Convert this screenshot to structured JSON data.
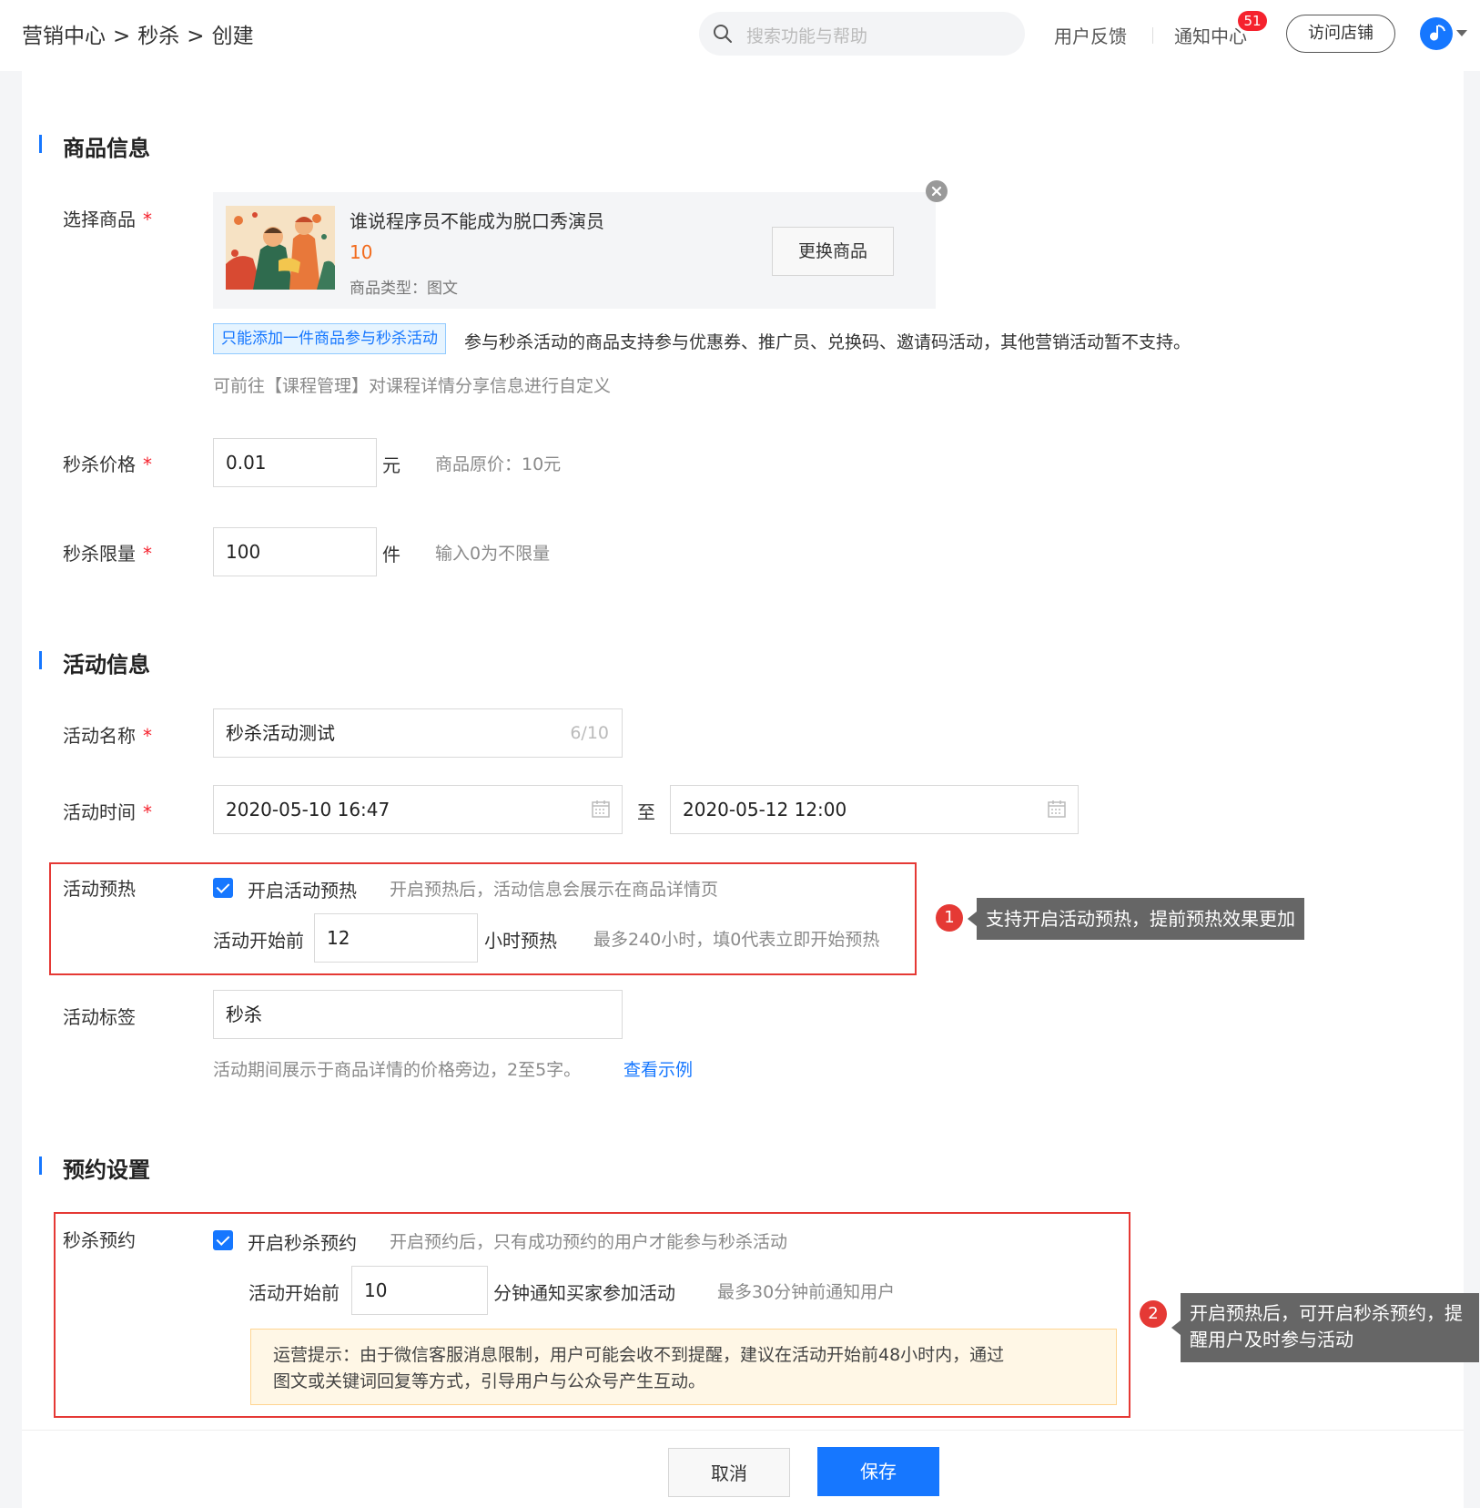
{
  "header": {
    "breadcrumb": [
      "营销中心",
      "秒杀",
      "创建"
    ],
    "breadcrumb_sep": ">",
    "search_placeholder": "搜索功能与帮助",
    "feedback": "用户反馈",
    "notify": "通知中心",
    "notify_badge": "51",
    "visit_shop": "访问店铺"
  },
  "product_section": {
    "title": "商品信息",
    "select_label": "选择商品",
    "product_title": "谁说程序员不能成为脱口秀演员",
    "product_price": "10",
    "product_type": "商品类型：图文",
    "change_button": "更换商品",
    "limit_tag": "只能添加一件商品参与秒杀活动",
    "support_text": "参与秒杀活动的商品支持参与优惠券、推广员、兑换码、邀请码活动，其他营销活动暂不支持。",
    "customize_hint": "可前往【课程管理】对课程详情分享信息进行自定义",
    "price_label": "秒杀价格",
    "price_value": "0.01",
    "price_unit": "元",
    "original_price": "商品原价：10元",
    "limit_label": "秒杀限量",
    "limit_value": "100",
    "limit_unit": "件",
    "limit_hint": "输入0为不限量"
  },
  "activity_section": {
    "title": "活动信息",
    "name_label": "活动名称",
    "name_value": "秒杀活动测试",
    "name_count": "6/10",
    "time_label": "活动时间",
    "start_time": "2020-05-10 16:47",
    "to": "至",
    "end_time": "2020-05-12 12:00",
    "preheat_label": "活动预热",
    "preheat_checkbox": "开启活动预热",
    "preheat_hint": "开启预热后，活动信息会展示在商品详情页",
    "preheat_before": "活动开始前",
    "preheat_hours": "12",
    "preheat_unit": "小时预热",
    "preheat_max": "最多240小时，填0代表立即开始预热",
    "tag_label": "活动标签",
    "tag_value": "秒杀",
    "tag_hint": "活动期间展示于商品详情的价格旁边，2至5字。",
    "tag_example_link": "查看示例"
  },
  "reserve_section": {
    "title": "预约设置",
    "reserve_label": "秒杀预约",
    "reserve_checkbox": "开启秒杀预约",
    "reserve_hint": "开启预约后，只有成功预约的用户才能参与秒杀活动",
    "reserve_before": "活动开始前",
    "reserve_minutes": "10",
    "reserve_unit": "分钟通知买家参加活动",
    "reserve_max": "最多30分钟前通知用户",
    "notice_line1": "运营提示：由于微信客服消息限制，用户可能会收不到提醒，建议在活动开始前48小时内，通过",
    "notice_line2": "图文或关键词回复等方式，引导用户与公众号产生互动。"
  },
  "annotations": {
    "marker1": "1",
    "tip1": "支持开启活动预热，提前预热效果更加",
    "marker2": "2",
    "tip2_line1": "开启预热后，可开启秒杀预约，提",
    "tip2_line2": "醒用户及时参与活动"
  },
  "footer": {
    "cancel": "取消",
    "save": "保存"
  },
  "colors": {
    "primary": "#1677ff",
    "danger": "#e53935",
    "price": "#f26b1d"
  }
}
